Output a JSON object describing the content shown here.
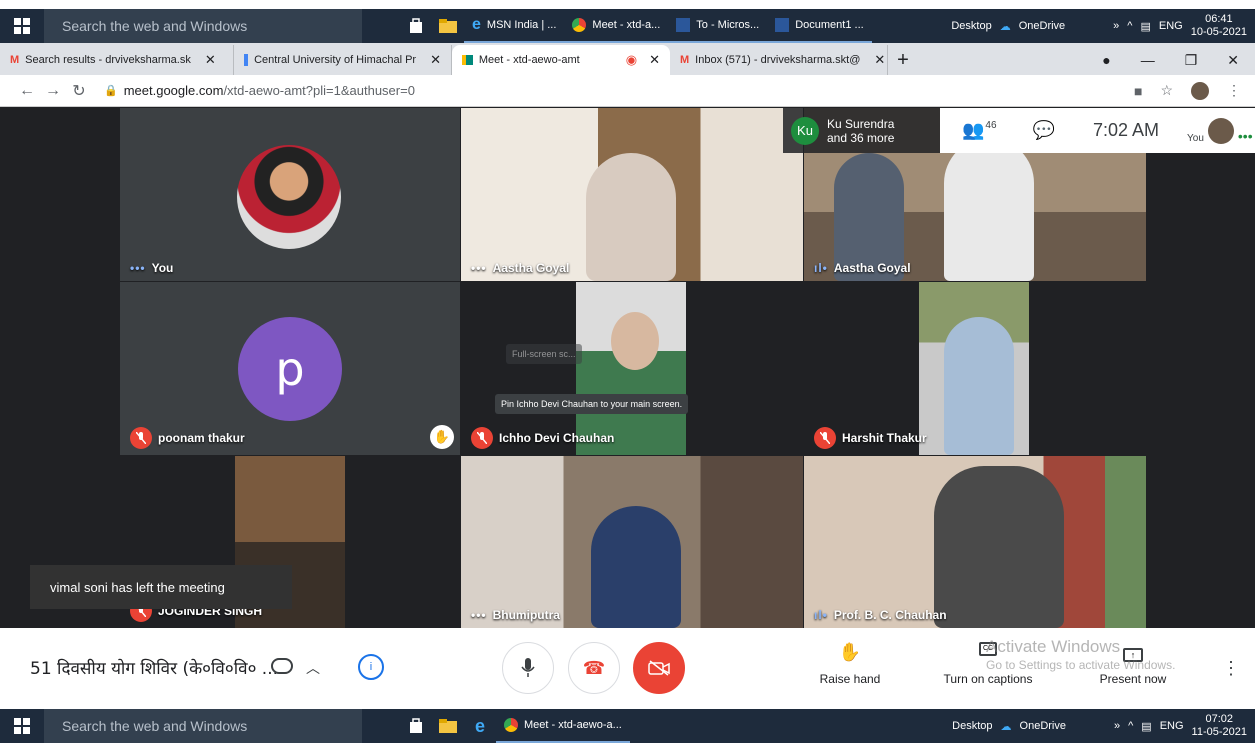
{
  "taskbar_top": {
    "search": "Search the web and Windows",
    "apps": [
      "MSN India | ...",
      "Meet - xtd-a...",
      "To - Micros...",
      "Document1 ..."
    ],
    "desktop": "Desktop",
    "onedrive": "OneDrive",
    "lang": "ENG",
    "time": "06:41",
    "date": "10-05-2021"
  },
  "tabs": [
    {
      "label": "Search results - drviveksharma.sk",
      "icon": "gmail-icon"
    },
    {
      "label": "Central University of Himachal Pr",
      "icon": "calendar-icon"
    },
    {
      "label": "Meet - xtd-aewo-amt",
      "icon": "meet-icon"
    },
    {
      "label": "Inbox (571) - drviveksharma.skt@",
      "icon": "gmail-icon"
    }
  ],
  "address": {
    "host": "meet.google.com",
    "path": "/xtd-aewo-amt?pli=1&authuser=0"
  },
  "speaker": {
    "initials": "Ku",
    "line1": "Ku Surendra",
    "line2": "and 36 more"
  },
  "participants_count": "46",
  "clock": "7:02 AM",
  "you_label": "You",
  "tiles": [
    {
      "name": "You"
    },
    {
      "name": "Aastha Goyal"
    },
    {
      "name": "Aastha Goyal"
    },
    {
      "name": "poonam thakur",
      "initial": "p"
    },
    {
      "name": "Ichho Devi Chauhan"
    },
    {
      "name": "Harshit Thakur"
    },
    {
      "name": "JOGINDER SINGH"
    },
    {
      "name": "Bhumiputra"
    },
    {
      "name": "Prof. B. C. Chauhan"
    }
  ],
  "tooltip_pin": "Pin Ichho Devi Chauhan to your main screen.",
  "tooltip_full": "Full-screen sc...",
  "toast": "vimal soni has left the meeting",
  "meeting_title": "51 दिवसीय योग शिविर (के०वि०वि० ...",
  "controls": {
    "raise_hand": "Raise hand",
    "captions": "Turn on captions",
    "present": "Present now"
  },
  "watermark": {
    "line1": "Activate Windows",
    "line2": "Go to Settings to activate Windows."
  },
  "taskbar_bottom": {
    "search": "Search the web and Windows",
    "app": "Meet - xtd-aewo-a...",
    "desktop": "Desktop",
    "onedrive": "OneDrive",
    "lang": "ENG",
    "time": "07:02",
    "date": "11-05-2021"
  }
}
